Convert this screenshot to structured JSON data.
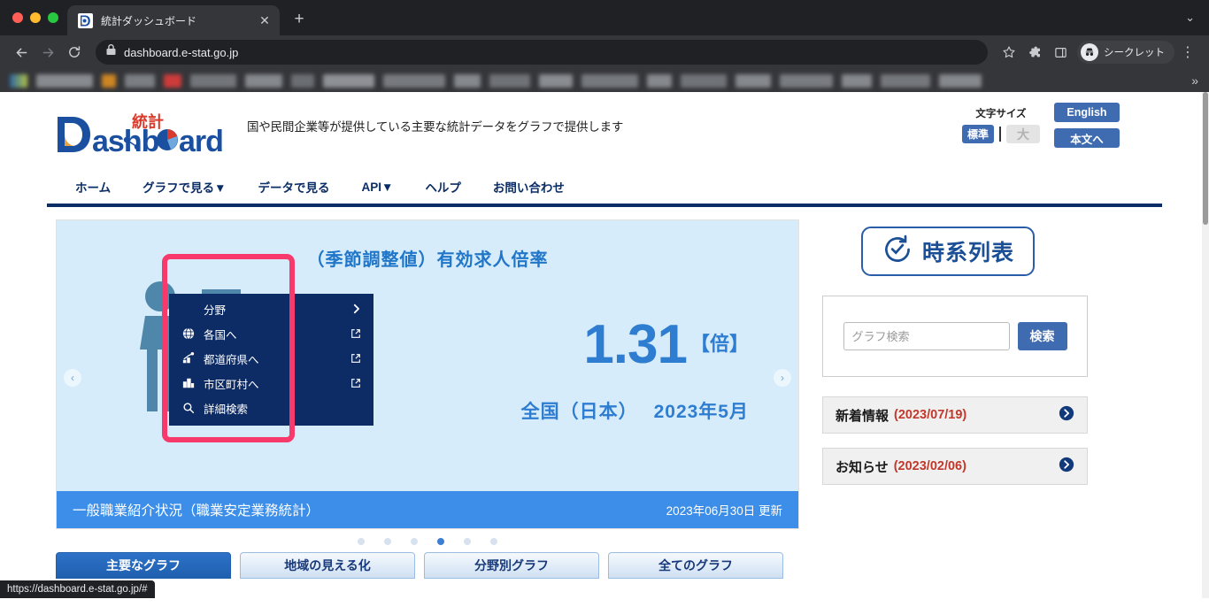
{
  "browser": {
    "tab": {
      "title": "統計ダッシュボード",
      "favicon_name": "estat-dashboard-favicon",
      "close_label": "✕"
    },
    "newtab_label": "+",
    "tabstrip_chevron": "⌄",
    "back_label": "←",
    "forward_label": "→",
    "reload_label": "⟳",
    "url": "dashboard.e-stat.go.jp",
    "lock_icon": "lock-icon",
    "star_label": "☆",
    "extensions_label": "puzzle-piece-icon",
    "sidepanel_label": "side-panel-icon",
    "incognito_label": "シークレット",
    "menu_label": "⋮",
    "bookmarks_overflow": "»",
    "status_url": "https://dashboard.e-stat.go.jp/#"
  },
  "header": {
    "logo_main": "Dashboard",
    "logo_badge": "統計",
    "tagline": "国や民間企業等が提供している主要な統計データをグラフで提供します",
    "fontsize_label": "文字サイズ",
    "fontsize_standard": "標準",
    "fontsize_large": "大",
    "english_label": "English",
    "skip_label": "本文へ"
  },
  "nav": {
    "items": [
      {
        "label": "ホーム",
        "active": false
      },
      {
        "label": "グラフで見る▼",
        "active": true
      },
      {
        "label": "データで見る",
        "active": false
      },
      {
        "label": "API▼",
        "active": false
      },
      {
        "label": "ヘルプ",
        "active": false
      },
      {
        "label": "お問い合わせ",
        "active": false
      }
    ]
  },
  "dropdown": {
    "items": [
      {
        "label": "分野",
        "icon": "none",
        "right": "chevron-right-icon"
      },
      {
        "label": "各国へ",
        "icon": "globe-icon",
        "right": "external-link-icon"
      },
      {
        "label": "都道府県へ",
        "icon": "chart-icon",
        "right": "external-link-icon"
      },
      {
        "label": "市区町村へ",
        "icon": "building-icon",
        "right": "external-link-icon"
      },
      {
        "label": "詳細検索",
        "icon": "search-icon",
        "right": "none"
      }
    ]
  },
  "carousel": {
    "title": "（季節調整値）有効求人倍率",
    "value": "1.31",
    "unit": "【倍】",
    "region": "全国（日本）",
    "period": "2023年5月",
    "caption_title": "一般職業紹介状況（職業安定業務統計）",
    "caption_date": "2023年06月30日 更新",
    "prev_label": "‹",
    "next_label": "›",
    "dots_total": 6,
    "dots_active_index": 3
  },
  "graph_tabs": [
    {
      "label": "主要なグラフ",
      "active": true
    },
    {
      "label": "地域の見える化",
      "active": false
    },
    {
      "label": "分野別グラフ",
      "active": false
    },
    {
      "label": "全てのグラフ",
      "active": false
    }
  ],
  "sidebar": {
    "timeseries_label": "時系列表",
    "timeseries_icon": "clock-icon",
    "search_placeholder": "グラフ検索",
    "search_value": "",
    "search_button": "検索",
    "info_rows": [
      {
        "label": "新着情報",
        "date": "(2023/07/19)",
        "arrow": "arrow-right-circle-icon"
      },
      {
        "label": "お知らせ",
        "date": "(2023/02/06)",
        "arrow": "arrow-right-circle-icon"
      }
    ]
  },
  "colors": {
    "brand_navy": "#0d2c66",
    "brand_blue": "#3f6bb0",
    "highlight_pink": "#f8396b",
    "carousel_bg": "#d6ecfb",
    "caption_blue": "#3c8ee8",
    "accent_red": "#c0392b"
  }
}
